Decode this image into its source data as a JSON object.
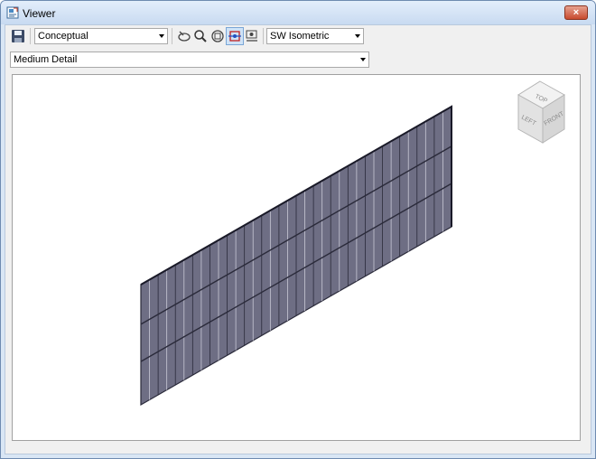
{
  "window": {
    "title": "Viewer",
    "close_label": "×"
  },
  "toolbar": {
    "visual_style": "Conceptual",
    "view_orientation": "SW Isometric",
    "detail_level": "Medium Detail"
  },
  "viewcube": {
    "top": "TOP",
    "left": "LEFT",
    "front": "FRONT"
  },
  "model": {
    "panel_color": "#6e6e84",
    "line_color": "#2a2a3a"
  }
}
